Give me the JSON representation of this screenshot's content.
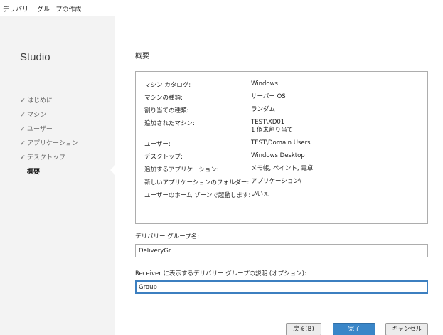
{
  "window": {
    "title": "デリバリー グループの作成"
  },
  "sidebar": {
    "brand": "Studio",
    "steps": [
      {
        "label": "はじめに",
        "done": true
      },
      {
        "label": "マシン",
        "done": true
      },
      {
        "label": "ユーザー",
        "done": true
      },
      {
        "label": "アプリケーション",
        "done": true
      },
      {
        "label": "デスクトップ",
        "done": true
      },
      {
        "label": "概要",
        "done": false,
        "current": true
      }
    ],
    "check_glyph": "✔"
  },
  "main": {
    "heading": "概要",
    "summary": [
      {
        "label": "マシン カタログ:",
        "value": "Windows"
      },
      {
        "label": "マシンの種類:",
        "value": "サーバー OS"
      },
      {
        "label": "割り当ての種類:",
        "value": "ランダム"
      },
      {
        "label": "追加されたマシン:",
        "value": "TEST\\XD01",
        "value2": "1 個未割り当て"
      },
      {
        "label": "ユーザー:",
        "value": "TEST\\Domain Users"
      },
      {
        "label": "デスクトップ:",
        "value": "Windows Desktop"
      },
      {
        "label": "追加するアプリケーション:",
        "value": "メモ帳, ペイント, 電卓"
      },
      {
        "label": "新しいアプリケーションのフォルダー:",
        "value": "アプリケーション\\"
      },
      {
        "label": "ユーザーのホーム ゾーンで起動します:",
        "value": "いいえ"
      }
    ],
    "group_name": {
      "label": "デリバリー グループ名:",
      "value": "DeliveryGr"
    },
    "description": {
      "label": "Receiver に表示するデリバリー グループの説明 (オプション):",
      "value": "Group"
    }
  },
  "buttons": {
    "back": "戻る(B)",
    "finish": "完了",
    "cancel": "キャンセル"
  },
  "colors": {
    "accent": "#3a86c8",
    "sidebar_bg": "#f3f3f3"
  }
}
